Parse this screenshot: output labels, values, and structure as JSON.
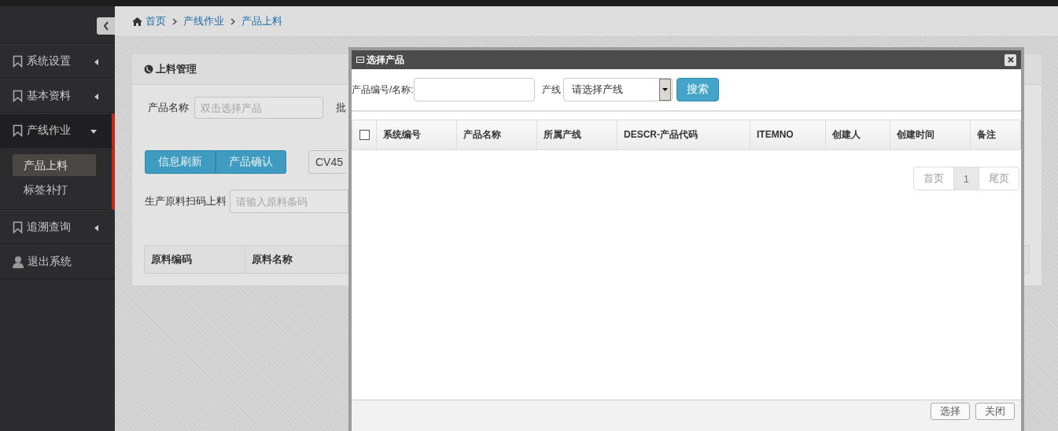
{
  "breadcrumb": [
    {
      "label": "首页"
    },
    {
      "label": "产线作业"
    },
    {
      "label": "产品上料"
    }
  ],
  "sidebar": {
    "items": [
      {
        "label": "系统设置",
        "kind": "menu",
        "expanded": false
      },
      {
        "label": "基本资料",
        "kind": "menu",
        "expanded": false
      },
      {
        "label": "产线作业",
        "kind": "menu",
        "expanded": true,
        "children": [
          {
            "label": "产品上料",
            "selected": true
          },
          {
            "label": "标签补打",
            "selected": false
          }
        ]
      },
      {
        "label": "追溯查询",
        "kind": "menu",
        "expanded": false
      },
      {
        "label": "退出系统",
        "kind": "logout"
      }
    ]
  },
  "panel": {
    "title": "上料管理",
    "product_label": "产品名称",
    "product_placeholder": "双击选择产品",
    "batch_label": "批",
    "buttons": [
      "信息刷新",
      "产品确认"
    ],
    "line_value": "CV45",
    "scan_label": "生产原料扫码上料",
    "scan_placeholder": "请输入原料条码",
    "columns": [
      "原料编码",
      "原料名称"
    ]
  },
  "dialog": {
    "title": "选择产品",
    "code_label": "产品编号/名称:",
    "line_label": "产线",
    "line_placeholder": "请选择产线",
    "search_button": "搜索",
    "select_all": {
      "checked": false
    },
    "columns": [
      "系统编号",
      "产品名称",
      "所属产线",
      "DESCR-产品代码",
      "ITEMNO",
      "创建人",
      "创建时间",
      "备注"
    ],
    "pager": [
      {
        "label": "首页",
        "selected": false
      },
      {
        "label": "1",
        "selected": true
      },
      {
        "label": "尾页",
        "selected": false
      }
    ],
    "footer_buttons": [
      "选择",
      "关闭"
    ]
  }
}
